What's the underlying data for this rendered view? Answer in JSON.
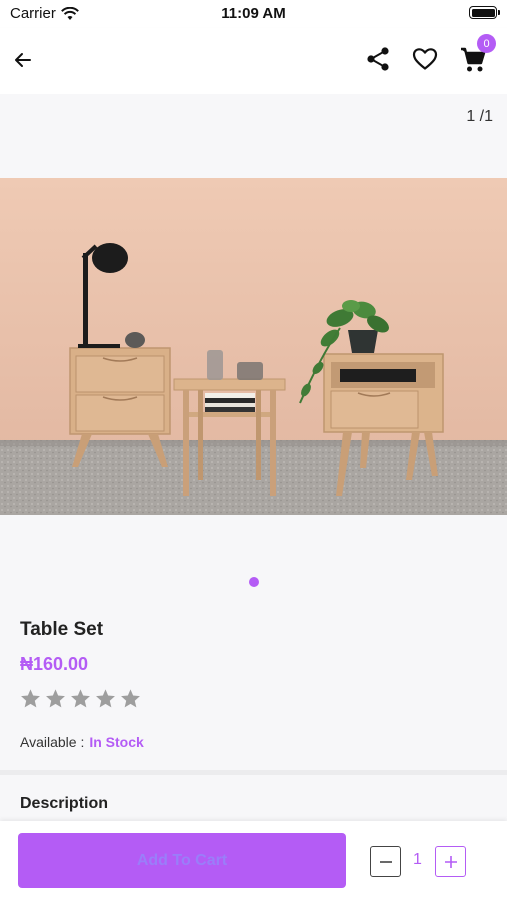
{
  "status_bar": {
    "carrier": "Carrier",
    "time": "11:09 AM"
  },
  "header": {
    "icons": [
      "back-arrow-icon",
      "share-icon",
      "heart-icon",
      "cart-icon"
    ],
    "cart_count": "0"
  },
  "gallery": {
    "counter": "1 /1",
    "active_page": 1,
    "total_pages": 1
  },
  "product": {
    "name": "Table Set",
    "price": "₦160.00",
    "rating": 0,
    "rating_max": 5,
    "availability_label": "Available :",
    "availability_value": "In Stock"
  },
  "description": {
    "title": "Description"
  },
  "cart_bar": {
    "add_label": "Add To Cart",
    "quantity": "1"
  },
  "colors": {
    "accent": "#b45cf5",
    "star_empty": "#9e9e9e",
    "background": "#f7f7f9",
    "wall": "#e9c3ad",
    "floor": "#a8a39e",
    "wood": "#dcb58b"
  }
}
